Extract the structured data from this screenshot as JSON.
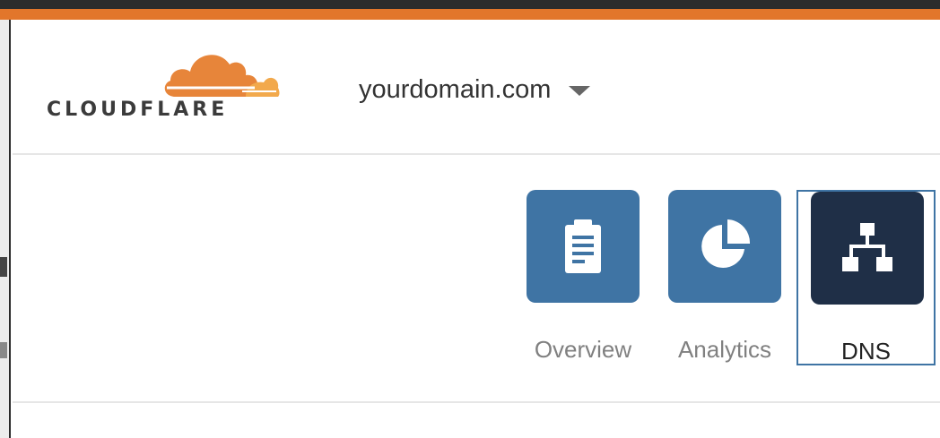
{
  "brand": {
    "wordmark": "CLOUDFLARE",
    "logo_icon": "cloud-logo",
    "accent_color": "#e2762b"
  },
  "header": {
    "domain": "yourdomain.com",
    "caret_icon": "caret-down-icon"
  },
  "nav": {
    "tabs": [
      {
        "label": "Overview",
        "icon": "clipboard-icon",
        "active": false,
        "tile_color": "#3f74a4"
      },
      {
        "label": "Analytics",
        "icon": "pie-chart-icon",
        "active": false,
        "tile_color": "#3f74a4"
      },
      {
        "label": "DNS",
        "icon": "sitemap-icon",
        "active": true,
        "tile_color": "#1f2f47"
      }
    ]
  }
}
